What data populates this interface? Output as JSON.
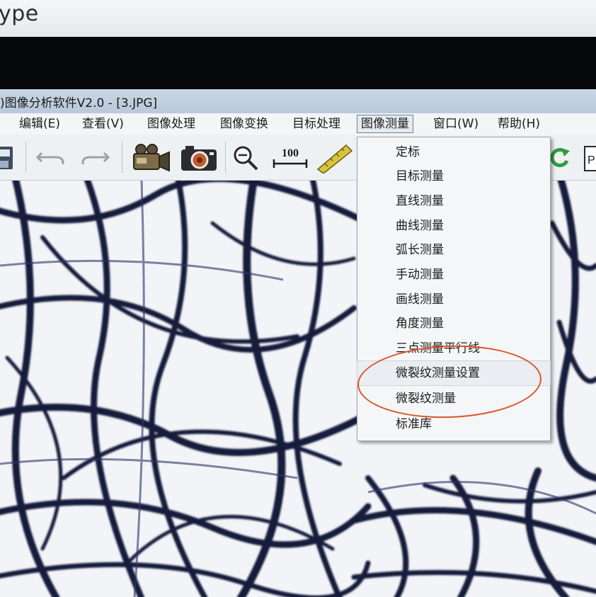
{
  "skype": {
    "title": "ype"
  },
  "window": {
    "title": ")图像分析软件V2.0 - [3.JPG]"
  },
  "menubar": {
    "items": [
      {
        "label": "编辑(E)"
      },
      {
        "label": "查看(V)"
      },
      {
        "label": "图像处理"
      },
      {
        "label": "图像变换"
      },
      {
        "label": "目标处理"
      },
      {
        "label": "图像测量"
      },
      {
        "label": "窗口(W)"
      },
      {
        "label": "帮助(H)"
      }
    ],
    "active_index": 5
  },
  "toolbar": {
    "scale_label": "100",
    "buttons": [
      "save-icon",
      "undo-icon",
      "redo-icon",
      "video-camera-icon",
      "camera-icon",
      "zoom-out-icon",
      "scale-bar-icon",
      "ruler-icon",
      "refresh-icon",
      "print-preview-icon"
    ],
    "right_partial_text": "P"
  },
  "dropdown": {
    "items": [
      {
        "label": "定标"
      },
      {
        "label": "目标测量"
      },
      {
        "label": "直线测量"
      },
      {
        "label": "曲线测量"
      },
      {
        "label": "弧长测量"
      },
      {
        "label": "手动测量"
      },
      {
        "label": "画线测量"
      },
      {
        "label": "角度测量"
      },
      {
        "label": "三点测量平行线"
      },
      {
        "label": "微裂纹测量设置"
      },
      {
        "label": "微裂纹测量"
      },
      {
        "label": "标准库"
      }
    ],
    "hovered_index": 9
  },
  "colors": {
    "annotation": "#d9542c",
    "fiber": "#141a3a",
    "menu_bg": "#f5f6f7",
    "titlebar": "#c2d0e0"
  }
}
